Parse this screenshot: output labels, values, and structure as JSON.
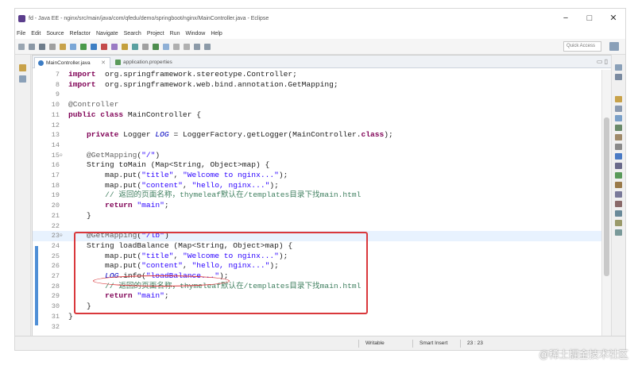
{
  "window": {
    "title": "fd - Java EE - nginx/src/main/java/com/qfedu/demo/springboot/nginx/MainController.java - Eclipse",
    "controls": {
      "minimize": "−",
      "maximize": "□",
      "close": "✕"
    }
  },
  "menu": [
    "File",
    "Edit",
    "Source",
    "Refactor",
    "Navigate",
    "Search",
    "Project",
    "Run",
    "Window",
    "Help"
  ],
  "toolbar": {
    "quick_access_placeholder": "Quick Access"
  },
  "tabs": [
    {
      "label": "MainController.java",
      "close": "✕",
      "active": true
    },
    {
      "label": "application.properties",
      "close": "",
      "active": false
    }
  ],
  "editor_controls": "▭ ▯",
  "code_lines": [
    {
      "num": "7",
      "fold": "",
      "text": ""
    },
    {
      "num": "8",
      "fold": "",
      "text": ""
    },
    {
      "num": "9",
      "fold": "",
      "text": ""
    },
    {
      "num": "10",
      "fold": "",
      "text": ""
    },
    {
      "num": "11",
      "fold": "",
      "text": ""
    },
    {
      "num": "12",
      "fold": "",
      "text": ""
    },
    {
      "num": "13",
      "fold": "",
      "text": ""
    },
    {
      "num": "14",
      "fold": "",
      "text": ""
    },
    {
      "num": "15",
      "fold": "⊖",
      "text": ""
    },
    {
      "num": "16",
      "fold": "",
      "text": ""
    },
    {
      "num": "17",
      "fold": "",
      "text": ""
    },
    {
      "num": "18",
      "fold": "",
      "text": ""
    },
    {
      "num": "19",
      "fold": "",
      "text": ""
    },
    {
      "num": "20",
      "fold": "",
      "text": ""
    },
    {
      "num": "21",
      "fold": "",
      "text": ""
    },
    {
      "num": "22",
      "fold": "",
      "text": ""
    },
    {
      "num": "23",
      "fold": "⊖",
      "text": ""
    },
    {
      "num": "24",
      "fold": "",
      "text": ""
    },
    {
      "num": "25",
      "fold": "",
      "text": ""
    },
    {
      "num": "26",
      "fold": "",
      "text": ""
    },
    {
      "num": "27",
      "fold": "",
      "text": ""
    },
    {
      "num": "28",
      "fold": "",
      "text": ""
    },
    {
      "num": "29",
      "fold": "",
      "text": ""
    },
    {
      "num": "30",
      "fold": "",
      "text": ""
    },
    {
      "num": "31",
      "fold": "",
      "text": ""
    },
    {
      "num": "32",
      "fold": "",
      "text": ""
    }
  ],
  "code_tokens": {
    "l7": [
      [
        "kw",
        "import"
      ],
      [
        "",
        "  org.springframework.stereotype.Controller;"
      ]
    ],
    "l8": [
      [
        "kw",
        "import"
      ],
      [
        "",
        "  org.springframework.web.bind.annotation.GetMapping;"
      ]
    ],
    "l10": [
      [
        "ann",
        "@Controller"
      ]
    ],
    "l11": [
      [
        "kw",
        "public class"
      ],
      [
        "",
        " MainController {"
      ]
    ],
    "l13": [
      [
        "",
        "    "
      ],
      [
        "kw",
        "private"
      ],
      [
        "",
        " Logger "
      ],
      [
        "fld",
        "LOG"
      ],
      [
        "",
        " = LoggerFactory.getLogger(MainController."
      ],
      [
        "kw",
        "class"
      ],
      [
        "",
        ");"
      ]
    ],
    "l15": [
      [
        "",
        "    "
      ],
      [
        "ann",
        "@GetMapping"
      ],
      [
        "",
        "("
      ],
      [
        "str",
        "\"/\""
      ],
      [
        "",
        ")"
      ]
    ],
    "l16": [
      [
        "",
        "    String toMain (Map<String, Object>map) {"
      ]
    ],
    "l17": [
      [
        "",
        "        map.put("
      ],
      [
        "str",
        "\"title\""
      ],
      [
        "",
        ", "
      ],
      [
        "str",
        "\"Welcome to nginx...\""
      ],
      [
        "",
        ");"
      ]
    ],
    "l18": [
      [
        "",
        "        map.put("
      ],
      [
        "str",
        "\"content\""
      ],
      [
        "",
        ", "
      ],
      [
        "str",
        "\"hello, nginx...\""
      ],
      [
        "",
        ");"
      ]
    ],
    "l19": [
      [
        "",
        "        "
      ],
      [
        "cmt",
        "// 返回的页面名称，thymeleaf默认在/templates目录下找main.html"
      ]
    ],
    "l20": [
      [
        "",
        "        "
      ],
      [
        "kw",
        "return"
      ],
      [
        "",
        " "
      ],
      [
        "str",
        "\"main\""
      ],
      [
        "",
        ";"
      ]
    ],
    "l21": [
      [
        "",
        "    }"
      ]
    ],
    "l23": [
      [
        "",
        "    "
      ],
      [
        "ann",
        "@GetMapping"
      ],
      [
        "",
        "("
      ],
      [
        "str",
        "\"/lb\""
      ],
      [
        "",
        ")"
      ]
    ],
    "l24": [
      [
        "",
        "    String loadBalance (Map<String, Object>map) {"
      ]
    ],
    "l25": [
      [
        "",
        "        map.put("
      ],
      [
        "str",
        "\"title\""
      ],
      [
        "",
        ", "
      ],
      [
        "str",
        "\"Welcome to nginx...\""
      ],
      [
        "",
        ");"
      ]
    ],
    "l26": [
      [
        "",
        "        map.put("
      ],
      [
        "str",
        "\"content\""
      ],
      [
        "",
        ", "
      ],
      [
        "str",
        "\"hello, nginx...\""
      ],
      [
        "",
        ");"
      ]
    ],
    "l27": [
      [
        "",
        "        "
      ],
      [
        "fld",
        "LOG"
      ],
      [
        "",
        ".info("
      ],
      [
        "str",
        "\"loadBalance...\""
      ],
      [
        "",
        ");"
      ]
    ],
    "l28": [
      [
        "",
        "        "
      ],
      [
        "cmt",
        "// 返回的页面名称，thymeleaf默认在/templates目录下找main.html"
      ]
    ],
    "l29": [
      [
        "",
        "        "
      ],
      [
        "kw",
        "return"
      ],
      [
        "",
        " "
      ],
      [
        "str",
        "\"main\""
      ],
      [
        "",
        ";"
      ]
    ],
    "l30": [
      [
        "",
        "    }"
      ]
    ],
    "l31": [
      [
        "",
        "}"
      ]
    ]
  },
  "status": {
    "writable": "Writable",
    "insert_mode": "Smart Insert",
    "position": "23 : 23"
  },
  "watermark": "@稀土掘金技术社区",
  "colors": {
    "keyword": "#7f0055",
    "string": "#2a00ff",
    "comment": "#3f7f5f",
    "annotation": "#646464",
    "field": "#0000c0",
    "highlight": "#d9383c"
  }
}
